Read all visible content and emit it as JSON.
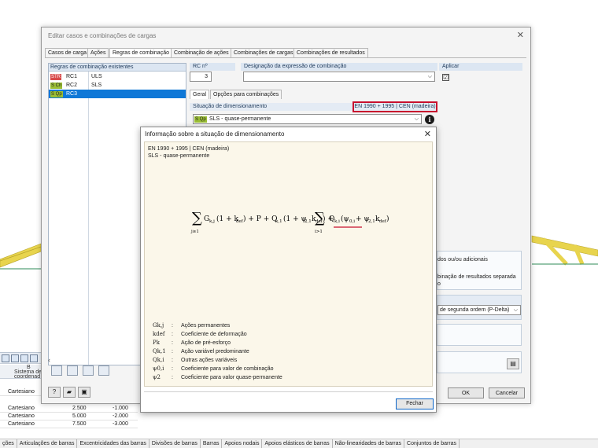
{
  "main_dialog": {
    "title": "Editar casos e combinações de cargas",
    "tabs": [
      "Casos de carga",
      "Ações",
      "Regras de combinação",
      "Combinação de ações",
      "Combinações de cargas",
      "Combinações de resultados"
    ],
    "list": {
      "header": "Regras de combinação existentes",
      "rows": [
        {
          "badge": "STR",
          "id": "RC1",
          "name": "ULS"
        },
        {
          "badge": "S Ch",
          "id": "RC2",
          "name": "SLS"
        },
        {
          "badge": "S Qp",
          "id": "RC3",
          "name": ""
        }
      ]
    },
    "rc_label": "RC nº",
    "rc_value": "3",
    "designation_label": "Designação da expressão de combinação",
    "apply_label": "Aplicar",
    "apply_check": "☑",
    "subtabs": [
      "Geral",
      "Opções para combinações"
    ],
    "design_situation_label": "Situação de dimensionamento",
    "norm_label": "EN 1990 + 1995 | CEN (madeira)",
    "design_situation_badge": "S Qp",
    "design_situation_value": "SLS - quase-permanente",
    "right_texts": {
      "additional": "dos ou/ou adicionais",
      "result_combination_1": "binação de resultados separada",
      "result_combination_2": "o",
      "analysis_method": "de segunda ordem (P-Delta)"
    },
    "ok_label": "OK",
    "cancel_label": "Cancelar"
  },
  "info_dialog": {
    "title": "Informação sobre a situação de dimensionamento",
    "norm": "EN 1990 + 1995 | CEN (madeira)",
    "situation": "SLS - quase-permanente",
    "formula": {
      "sum1_sub": "j≥1",
      "term1": "G",
      "term1_sub": "k,j",
      "term1_rest": "(1 + k",
      "kdef_sub": "def",
      "term1_close": ") + P + Q",
      "q1_sub": "k,1",
      "q1_rest": "(1 + ψ",
      "psi21_sub": "2,1",
      "q1_k": "k",
      "q1_close": ") + ",
      "sum2_sub": "i>1",
      "term2": "Q",
      "term2_sub": "k,i",
      "term2_rest": "(ψ",
      "psi0_sub": "0,i",
      "term2_plus": " + ψ",
      "psi2_sub": "2,1",
      "term2_k": "k",
      "term2_close": ")"
    },
    "legend": [
      {
        "sym": "Gk,j",
        "desc": "Ações permanentes"
      },
      {
        "sym": "kdef",
        "desc": "Coeficiente de deformação"
      },
      {
        "sym": "Pk",
        "desc": "Ação de pré-esforço"
      },
      {
        "sym": "Qk,1",
        "desc": "Ação variável predominante"
      },
      {
        "sym": "Qk,i",
        "desc": "Outras ações variáveis"
      },
      {
        "sym": "ψ0,i",
        "desc": "Coeficiente para valor de combinação"
      },
      {
        "sym": "ψ2",
        "desc": "Coeficiente para valor quase-permanente"
      }
    ],
    "colon": ":",
    "close_label": "Fechar"
  },
  "bg_table": {
    "col_b": "B",
    "col_b_sub": "Sistema de",
    "col_b_sub2": "coordenad",
    "rows": [
      {
        "system": "Cartesiano",
        "x": "",
        "y": ""
      },
      {
        "system": "Cartesiano",
        "x": "2.500",
        "y": "-1.000"
      },
      {
        "system": "Cartesiano",
        "x": "5.000",
        "y": "-2.000"
      },
      {
        "system": "Cartesiano",
        "x": "7.500",
        "y": "-3.000"
      }
    ]
  },
  "bottom_tabs": [
    "ções",
    "Articulações de barras",
    "Excentricidades das barras",
    "Divisões de barras",
    "Barras",
    "Apoios nodais",
    "Apoios elásticos de barras",
    "Não-linearidades de barras",
    "Conjuntos de barras"
  ],
  "colors": {
    "selection": "#0f78d7",
    "highlight_red": "#c8102e",
    "truss_yellow": "#e8d44d",
    "str_badge": "#d84a4a",
    "sch_badge": "#9bbf34"
  }
}
